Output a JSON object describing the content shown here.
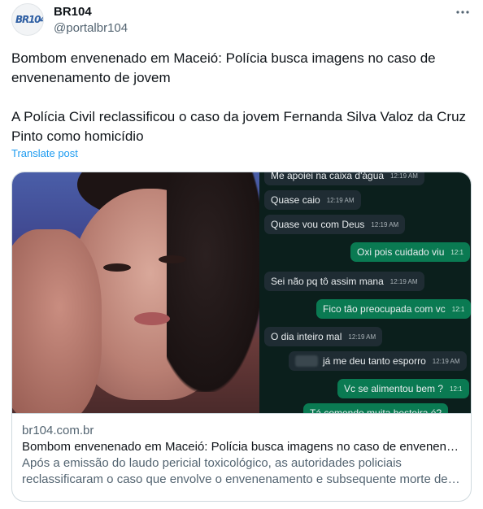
{
  "author": {
    "name": "BR104",
    "handle": "@portalbr104",
    "avatar_logo": "BR104",
    "more_icon": "more-horizontal-icon"
  },
  "tweet": {
    "line1": "Bombom envenenado em Maceió: Polícia busca imagens no caso de envenenamento de jovem",
    "line2": "A Polícia Civil reclassificou o caso da jovem Fernanda Silva Valoz da Cruz Pinto como homicídio",
    "translate": "Translate post"
  },
  "card": {
    "chat": [
      {
        "text": "Me apoiei na caixa d'água",
        "time": "12:19 AM",
        "dir": "in"
      },
      {
        "text": "Quase caio",
        "time": "12:19 AM",
        "dir": "in"
      },
      {
        "text": "Quase vou com Deus",
        "time": "12:19 AM",
        "dir": "in"
      },
      {
        "text": "Oxi pois cuidado viu",
        "time": "12:1",
        "dir": "out"
      },
      {
        "text": "Sei não pq tô assim mana",
        "time": "12:19 AM",
        "dir": "in"
      },
      {
        "text": "Fico tão preocupada com vc",
        "time": "12:1",
        "dir": "out"
      },
      {
        "text": "O dia inteiro mal",
        "time": "12:19 AM",
        "dir": "in"
      },
      {
        "text": "já me deu tanto esporro",
        "time": "12:19 AM",
        "dir": "in"
      },
      {
        "text": "Vc se alimentou bem ?",
        "time": "12:1",
        "dir": "out"
      },
      {
        "text": "Tá comendo muita besteira é?",
        "time": "",
        "dir": "out"
      }
    ],
    "domain": "br104.com.br",
    "title": "Bombom envenenado em Maceió: Polícia busca imagens no caso de envenenamento de jovem",
    "description_line1": "Após a emissão do laudo pericial toxicológico, as autoridades policiais",
    "description_line2": "reclassificaram o caso que envolve o envenenamento e subsequente morte de jovem"
  }
}
